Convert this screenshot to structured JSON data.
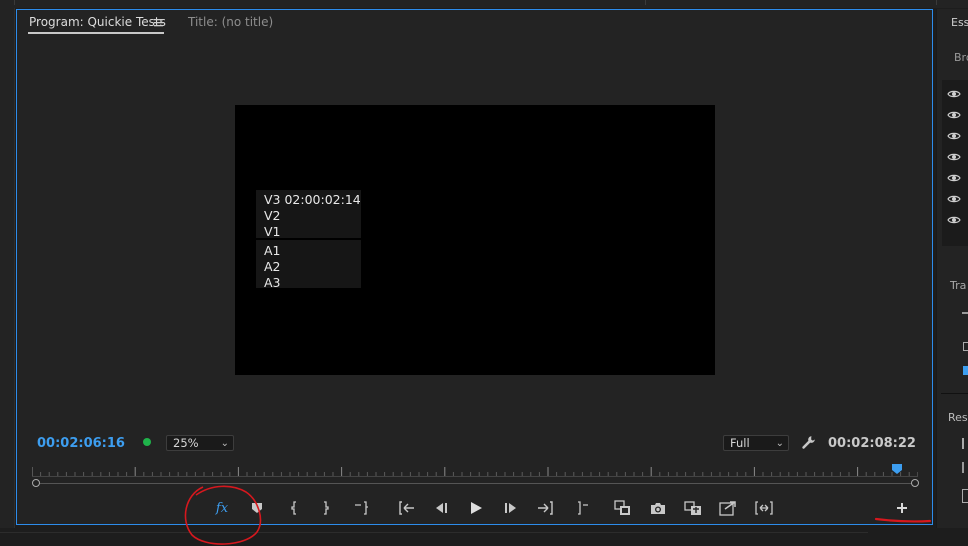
{
  "panel": {
    "tab_program": "Program: Quickie Tests",
    "tab_title": "Title: (no title)"
  },
  "overlay": {
    "video_lines": [
      "V3 02:00:02:14",
      "V2",
      "V1"
    ],
    "audio_lines": [
      "A1",
      "A2",
      "A3"
    ]
  },
  "controls": {
    "current_timecode": "00:02:06:16",
    "zoom_value": "25%",
    "quality_value": "Full",
    "duration_timecode": "00:02:08:22",
    "fx_label": "fx"
  },
  "timeline": {
    "playhead_position": 0.976
  },
  "right_panel": {
    "header": "Ess",
    "browse": "Bro",
    "track_label": "Tra",
    "resp_label": "Resp",
    "eye_rows": 7
  },
  "colors": {
    "accent": "#3d9ef0",
    "panel_border": "#2d8ceb",
    "status_dot": "#1fb34a",
    "annotation": "#d6181e"
  },
  "icons": [
    "menu-icon",
    "wrench-icon",
    "fx-icon",
    "marker-icon",
    "mark-in-icon",
    "mark-out-icon",
    "mark-clip-icon",
    "go-to-in-icon",
    "step-back-icon",
    "play-icon",
    "step-forward-icon",
    "go-to-out-icon",
    "lift-icon",
    "overwrite-icon",
    "camera-icon",
    "insert-icon",
    "extract-icon",
    "trim-icon",
    "add-button-icon",
    "eye-icon"
  ]
}
